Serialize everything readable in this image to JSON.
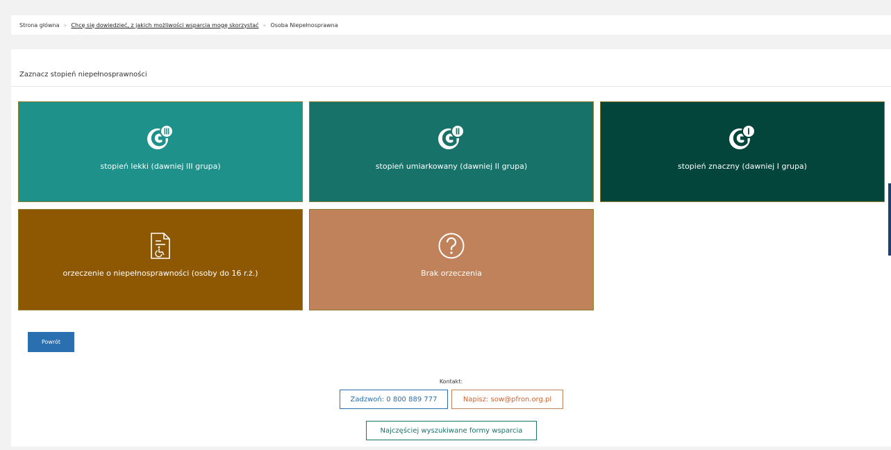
{
  "breadcrumb": {
    "home": "Strona główna",
    "link": "Chcę się dowiedzieć, z jakich możliwości wsparcia mogę skorzystać",
    "current": "Osoba Niepełnosprawna",
    "separator": "»"
  },
  "panel": {
    "title": "Zaznacz stopień niepełnosprawności"
  },
  "tiles": [
    {
      "label": "stopień lekki (dawniej III grupa)",
      "icon": "degree-iii-icon",
      "color": "#1e918a"
    },
    {
      "label": "stopień umiarkowany (dawniej II grupa)",
      "icon": "degree-ii-icon",
      "color": "#17726a"
    },
    {
      "label": "stopień znaczny (dawniej I grupa)",
      "icon": "degree-i-icon",
      "color": "#03443b"
    },
    {
      "label": "orzeczenie o niepełnosprawności (osoby do 16 r.ż.)",
      "icon": "document-wheelchair-icon",
      "color": "#8e5702"
    },
    {
      "label": "Brak orzeczenia",
      "icon": "question-circle-icon",
      "color": "#c0825a"
    }
  ],
  "back_button": "Powrót",
  "contact": {
    "label": "Kontakt:",
    "phone": "Zadzwoń: 0 800 889 777",
    "email": "Napisz: sow@pfron.org.pl",
    "forms": "Najczęściej wyszukiwane formy wsparcia"
  }
}
